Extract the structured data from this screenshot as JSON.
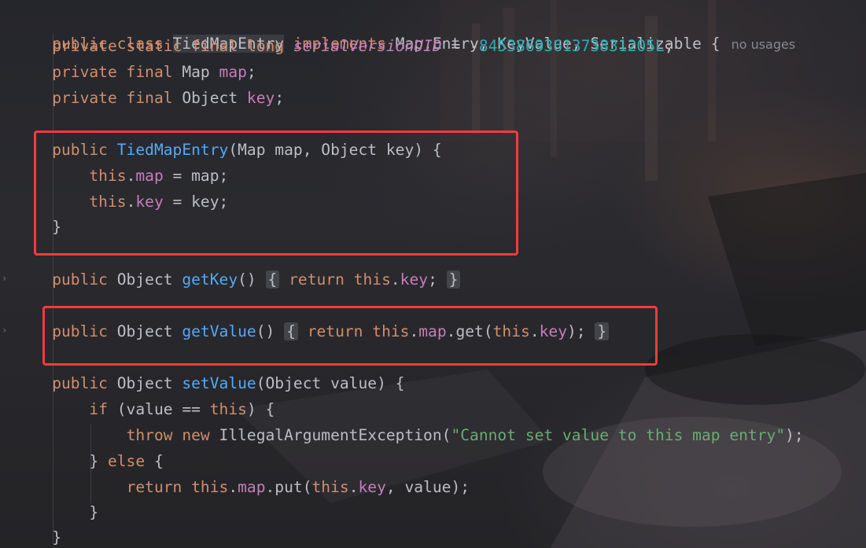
{
  "code": {
    "class_decl": {
      "kw_public": "public",
      "kw_class": "class",
      "class_name": "TiedMapEntry",
      "kw_implements": "implements",
      "interfaces": "Map.Entry, KeyValue, Serializable",
      "open": "{",
      "usage_hint": "no usages"
    },
    "field_uid": {
      "mods": "private static final long",
      "name": "serialVersionUID",
      "eq": " = -",
      "value": "8453869361373831205L",
      "end": ";"
    },
    "field_map": {
      "mods": "private final",
      "type": "Map",
      "name": "map",
      "end": ";"
    },
    "field_key": {
      "mods": "private final",
      "type": "Object",
      "name": "key",
      "end": ";"
    },
    "constructor": {
      "kw": "public",
      "name": "TiedMapEntry",
      "params": "(Map map, Object key) {",
      "kw_this": "this",
      "line1_field": "map",
      "line1_rest": " = map;",
      "line2_field": "key",
      "line2_rest": " = key;",
      "close": "}"
    },
    "get_key": {
      "kw": "public",
      "type": "Object",
      "name": "getKey",
      "parens": "()",
      "open": "{",
      "kw_return": "return",
      "kw_this": "this",
      "field": "key",
      "end": ";",
      "close": "}"
    },
    "get_value": {
      "kw": "public",
      "type": "Object",
      "name": "getValue",
      "parens": "()",
      "open": "{",
      "kw_return": "return",
      "kw_this": "this",
      "field": "map",
      "call": ".get(",
      "kw_this2": "this",
      "field2": "key",
      "end": ");",
      "close": "}"
    },
    "set_value": {
      "kw": "public",
      "type": "Object",
      "name": "setValue",
      "params": "(Object value) {",
      "kw_if": "if",
      "cond_a": " (value == ",
      "kw_this": "this",
      "cond_b": ") {",
      "kw_throw": "throw",
      "kw_new": "new",
      "exc": "IllegalArgumentException(",
      "message": "\"Cannot set value to this map entry\"",
      "exc_end": ");",
      "close_if": "}",
      "kw_else": "else",
      "else_open": "{",
      "kw_return": "return",
      "kw_this2": "this",
      "field_map": "map",
      "put_call": ".put(",
      "kw_this3": "this",
      "field_key": "key",
      "put_rest": ", value);",
      "close_else": "}",
      "close_method": "}"
    }
  },
  "colors": {
    "highlight_border": "#f43b3b",
    "keyword": "#cf8e6d",
    "function": "#56a8f5",
    "field": "#c77dbb",
    "number": "#2aacb8",
    "string": "#6aab73"
  }
}
